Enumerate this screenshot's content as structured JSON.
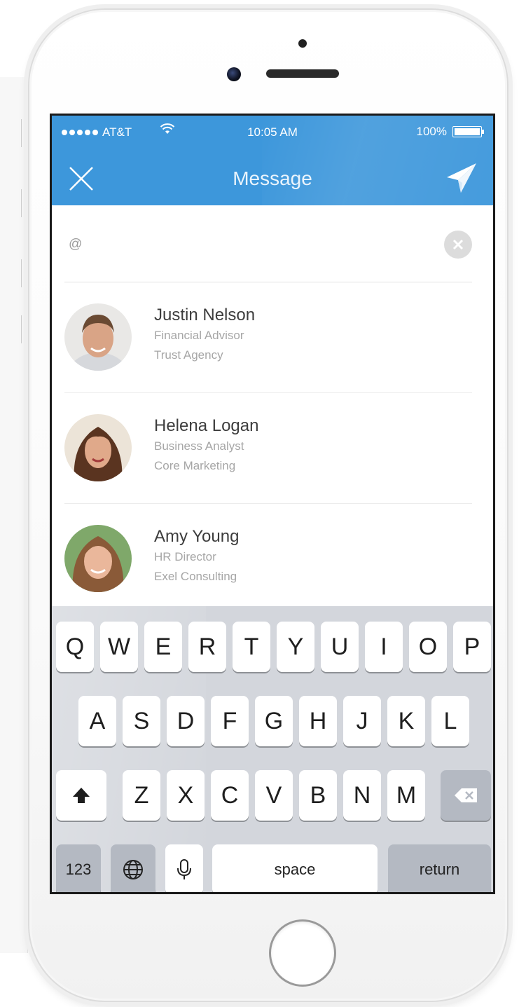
{
  "status_bar": {
    "carrier": "AT&T",
    "time": "10:05 AM",
    "battery": "100%"
  },
  "nav": {
    "title": "Message",
    "close_icon": "close-icon",
    "send_icon": "paper-plane-icon"
  },
  "search": {
    "value": "@"
  },
  "contacts": [
    {
      "name": "Justin Nelson",
      "title": "Financial Advisor",
      "company": "Trust Agency"
    },
    {
      "name": "Helena Logan",
      "title": "Business Analyst",
      "company": "Core Marketing"
    },
    {
      "name": "Amy Young",
      "title": "HR Director",
      "company": "Exel Consulting"
    }
  ],
  "keyboard": {
    "row1": [
      "Q",
      "W",
      "E",
      "R",
      "T",
      "Y",
      "U",
      "I",
      "O",
      "P"
    ],
    "row2": [
      "A",
      "S",
      "D",
      "F",
      "G",
      "H",
      "J",
      "K",
      "L"
    ],
    "row3": [
      "Z",
      "X",
      "C",
      "V",
      "B",
      "N",
      "M"
    ],
    "numbers_label": "123",
    "space_label": "space",
    "return_label": "return"
  },
  "colors": {
    "accent": "#3d97db",
    "keyboard_bg": "#d3d6dc"
  }
}
